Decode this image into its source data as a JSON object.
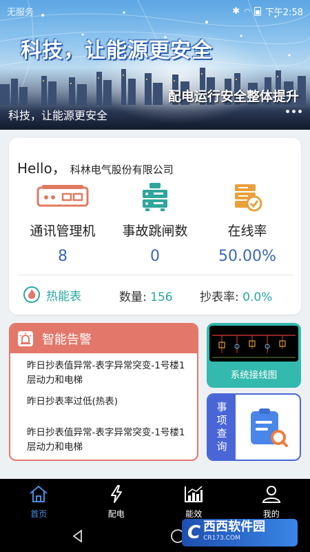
{
  "status_bar": {
    "carrier": "无服务",
    "time": "下午2:58"
  },
  "banner": {
    "title": "科技，让能源更安全",
    "subtitle": "配电运行安全整体提升",
    "caption": "科技，让能源更安全"
  },
  "summary": {
    "hello": "Hello，",
    "company": "科林电气股份有限公司",
    "stats": [
      {
        "label": "通讯管理机",
        "value": "8",
        "icon": "router-icon"
      },
      {
        "label": "事故跳闸数",
        "value": "0",
        "icon": "server-icon"
      },
      {
        "label": "在线率",
        "value": "50.00%",
        "icon": "database-check-icon"
      }
    ],
    "meter": {
      "name": "热能表",
      "count_label": "数量:",
      "count": "156",
      "rate_label": "抄表率:",
      "rate": "0.0%"
    }
  },
  "alarm": {
    "title": "智能告警",
    "items": [
      "昨日抄表值异常-表字异常突变-1号楼1层动力和电梯",
      "昨日抄表率过低(热表)",
      "昨日抄表值异常-表字异常突变-1号楼1层动力和电梯"
    ]
  },
  "tiles": {
    "wiring": "系统接线图",
    "query": "事项查询"
  },
  "bottom_nav": [
    {
      "label": "首页",
      "icon": "home-icon",
      "active": true
    },
    {
      "label": "配电",
      "icon": "lightning-icon",
      "active": false
    },
    {
      "label": "能效",
      "icon": "bar-chart-icon",
      "active": false
    },
    {
      "label": "我的",
      "icon": "user-icon",
      "active": false
    }
  ],
  "watermark": {
    "logo": "C",
    "name": "西西软件园",
    "url": "CR173.COM"
  },
  "colors": {
    "primary": "#3c66b5",
    "teal": "#27a89c",
    "alarm": "#e3776a",
    "wiring_tile": "#34b9ae",
    "query_tile": "#4a66d6",
    "nav_active": "#4a8fe0"
  }
}
